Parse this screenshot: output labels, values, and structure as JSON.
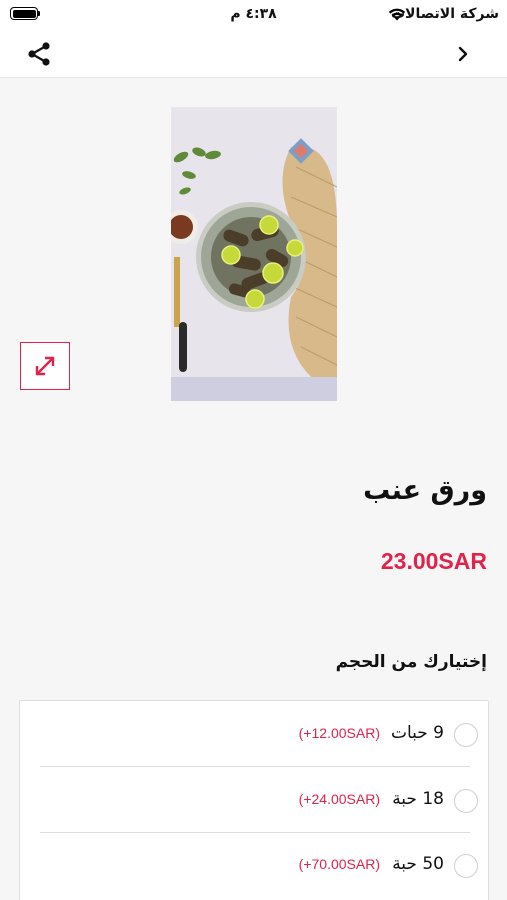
{
  "status_bar": {
    "carrier": "شركة الاتصالات",
    "time": "٤:٣٨ م"
  },
  "nav": {
    "share_icon": "share-icon",
    "back_icon": "chevron-right-icon"
  },
  "product": {
    "image_alt": "ورق عنب",
    "expand_icon": "expand-arrows-icon",
    "title": "ورق عنب",
    "price": "23.00SAR"
  },
  "options": {
    "title": "إختيارك من الحجم",
    "items": [
      {
        "label": "9 حبات",
        "price": "(+12.00SAR)"
      },
      {
        "label": "18 حبة",
        "price": "(+24.00SAR)"
      },
      {
        "label": "50 حبة",
        "price": "(+70.00SAR)"
      }
    ]
  },
  "colors": {
    "accent": "#e0234a",
    "background": "#f6f6f6"
  }
}
